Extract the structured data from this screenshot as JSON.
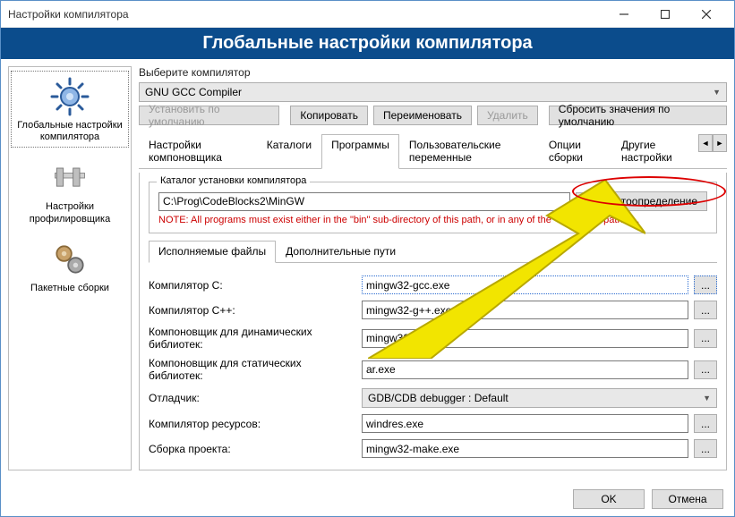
{
  "window": {
    "title": "Настройки компилятора"
  },
  "header": "Глобальные настройки компилятора",
  "sidebar": {
    "items": [
      {
        "label": "Глобальные настройки компилятора"
      },
      {
        "label": "Настройки профилировщика"
      },
      {
        "label": "Пакетные сборки"
      }
    ]
  },
  "compiler": {
    "select_label": "Выберите компилятор",
    "selected": "GNU GCC Compiler",
    "btn_default": "Установить по умолчанию",
    "btn_copy": "Копировать",
    "btn_rename": "Переименовать",
    "btn_delete": "Удалить",
    "btn_reset": "Сбросить значения по умолчанию"
  },
  "tabs": {
    "t0": "Настройки компоновщика",
    "t1": "Каталоги",
    "t2": "Программы",
    "t3": "Пользовательские переменные",
    "t4": "Опции сборки",
    "t5": "Другие настройки"
  },
  "install": {
    "legend": "Каталог установки компилятора",
    "path": "C:\\Prog\\CodeBlocks2\\MinGW",
    "browse": "...",
    "auto": "Автоопределение",
    "note": "NOTE: All programs must exist either in the \"bin\" sub-directory of this path, or in any of the \"Additional paths\"..."
  },
  "subtabs": {
    "s0": "Исполняемые файлы",
    "s1": "Дополнительные пути"
  },
  "form": {
    "c_label": "Компилятор C:",
    "c_val": "mingw32-gcc.exe",
    "cpp_label": "Компилятор C++:",
    "cpp_val": "mingw32-g++.exe",
    "dynlink_label": "Компоновщик для динамических библиотек:",
    "dynlink_val": "mingw32-g++.exe",
    "statlink_label": "Компоновщик для статических библиотек:",
    "statlink_val": "ar.exe",
    "debug_label": "Отладчик:",
    "debug_val": "GDB/CDB debugger : Default",
    "res_label": "Компилятор ресурсов:",
    "res_val": "windres.exe",
    "make_label": "Сборка проекта:",
    "make_val": "mingw32-make.exe",
    "browse": "..."
  },
  "footer": {
    "ok": "OK",
    "cancel": "Отмена"
  }
}
